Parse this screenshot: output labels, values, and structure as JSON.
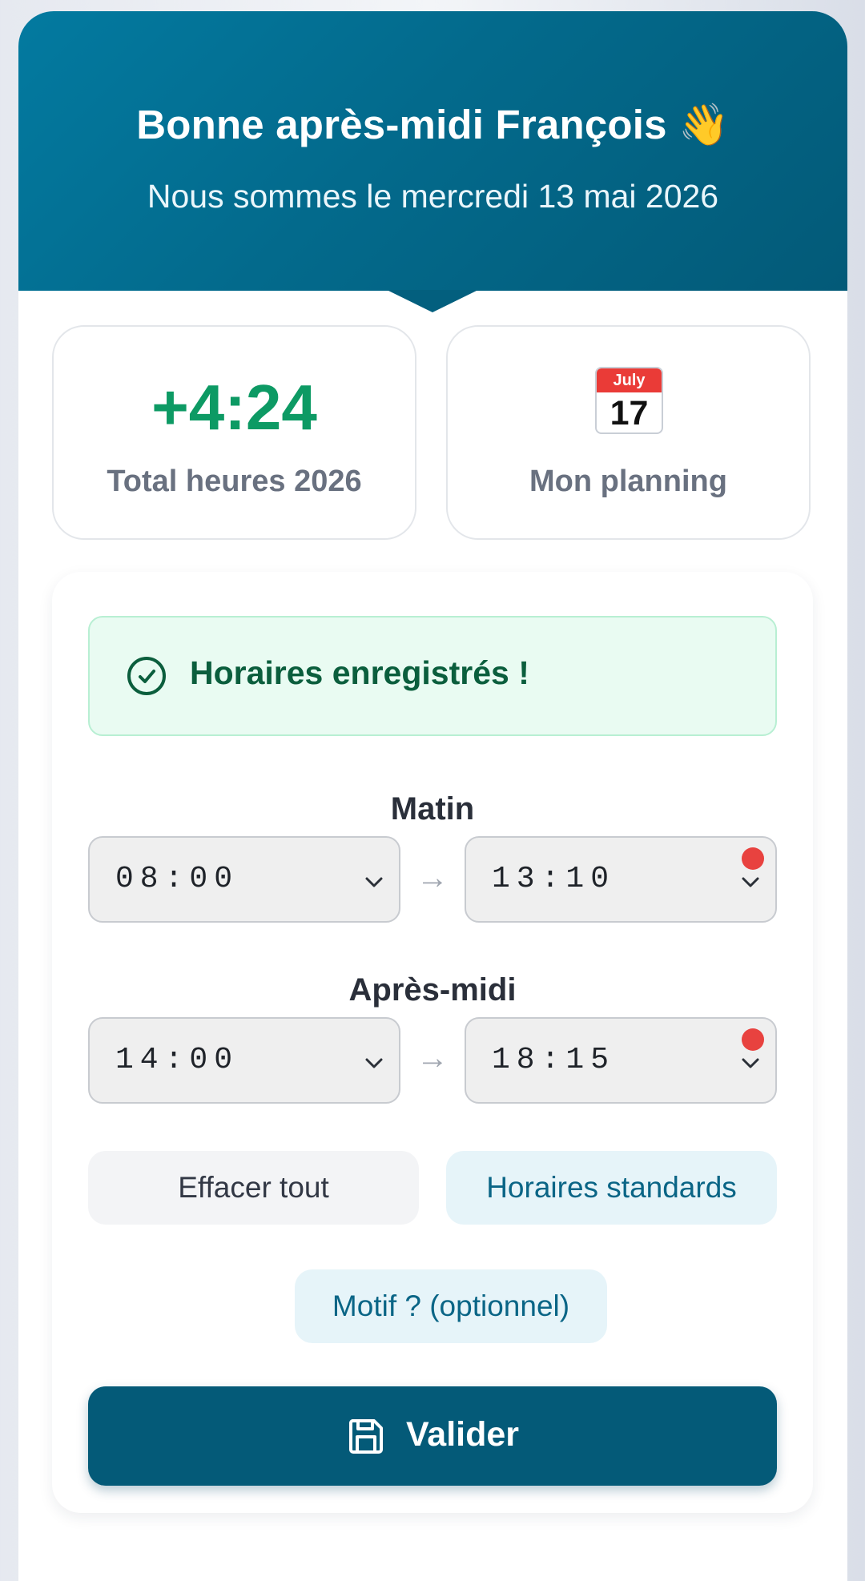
{
  "header": {
    "greeting": "Bonne après-midi François 👋",
    "date_text": "Nous sommes le mercredi 13 mai 2026"
  },
  "stats": {
    "total_hours_value": "+4:24",
    "total_hours_label": "Total heures 2026",
    "planning_calendar_month": "July",
    "planning_calendar_day": "17",
    "planning_label": "Mon planning"
  },
  "form": {
    "success_message": "Horaires enregistrés !",
    "morning": {
      "title": "Matin",
      "start": "08:00",
      "end": "13:10",
      "arrow": "→"
    },
    "afternoon": {
      "title": "Après-midi",
      "start": "14:00",
      "end": "18:15",
      "arrow": "→"
    },
    "clear_label": "Effacer tout",
    "standard_label": "Horaires standards",
    "reason_label": "Motif ? (optionnel)",
    "submit_label": "Valider"
  },
  "icons": {
    "success": "check-circle-icon",
    "calendar": "calendar-icon",
    "chevron": "chevron-down-icon",
    "save": "save-icon"
  },
  "colors": {
    "header": "#036a8c",
    "accent_green": "#0d9a64",
    "submit": "#045a78",
    "alert_dot": "#e8423f"
  }
}
